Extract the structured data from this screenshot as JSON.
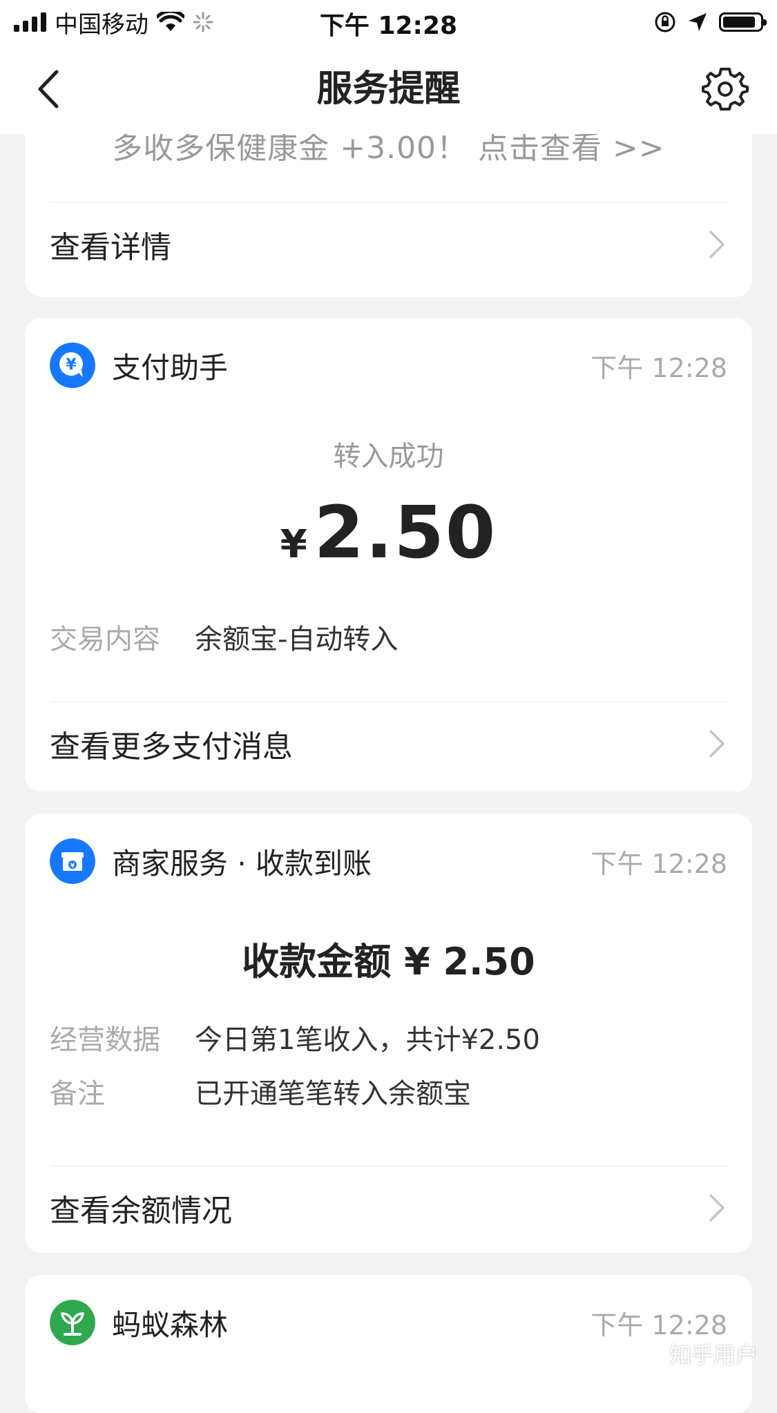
{
  "status_bar": {
    "carrier": "中国移动",
    "time": "下午 12:28"
  },
  "nav": {
    "title": "服务提醒"
  },
  "promo_card": {
    "text": "多收多保健康金 +3.00！ 点击查看 >>",
    "link_label": "查看详情"
  },
  "pay_card": {
    "app_name": "支付助手",
    "timestamp": "下午 12:28",
    "status": "转入成功",
    "currency": "¥",
    "amount": "2.50",
    "detail_label": "交易内容",
    "detail_value": "余额宝-自动转入",
    "link_label": "查看更多支付消息",
    "icon": "yuan-icon",
    "accent": "#1677ff"
  },
  "merchant_card": {
    "app_name": "商家服务 · 收款到账",
    "timestamp": "下午 12:28",
    "amount_text": "收款金额 ¥ 2.50",
    "rows": [
      {
        "label": "经营数据",
        "value": "今日第1笔收入，共计¥2.50"
      },
      {
        "label": "备注",
        "value": "已开通笔笔转入余额宝"
      }
    ],
    "link_label": "查看余额情况",
    "icon": "store-icon",
    "accent": "#1677ff"
  },
  "forest_card": {
    "app_name": "蚂蚁森林",
    "timestamp": "下午 12:28",
    "icon": "forest-icon",
    "accent": "#2fa84f"
  },
  "watermark": "知乎用户"
}
